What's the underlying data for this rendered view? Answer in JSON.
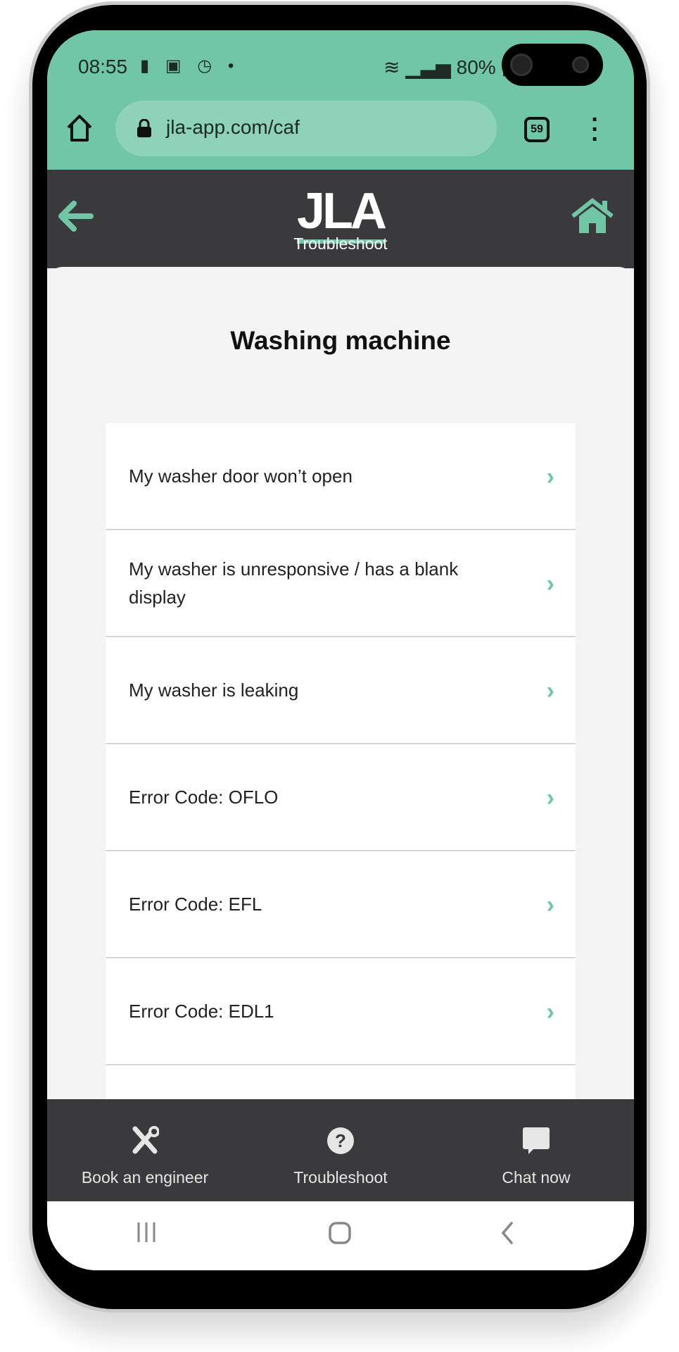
{
  "status_bar": {
    "time": "08:55",
    "battery": "80%"
  },
  "browser": {
    "url": "jla-app.com/caf",
    "tab_count": "59"
  },
  "header": {
    "logo": "JLA",
    "subtitle": "Troubleshoot"
  },
  "main": {
    "title": "Washing machine",
    "items": [
      {
        "label": "My washer door won’t open"
      },
      {
        "label": "My washer is unresponsive / has a blank display"
      },
      {
        "label": "My washer is leaking"
      },
      {
        "label": "Error Code: OFLO"
      },
      {
        "label": "Error Code: EFL"
      },
      {
        "label": "Error Code: EDL1"
      }
    ]
  },
  "bottom_nav": [
    {
      "label": "Book an engineer",
      "icon": "tools-icon"
    },
    {
      "label": "Troubleshoot",
      "icon": "question-circle-icon"
    },
    {
      "label": "Chat now",
      "icon": "chat-bubble-icon"
    }
  ],
  "colors": {
    "accent": "#70c6a5",
    "header": "#3a3a3c",
    "background": "#f3f3f3"
  }
}
